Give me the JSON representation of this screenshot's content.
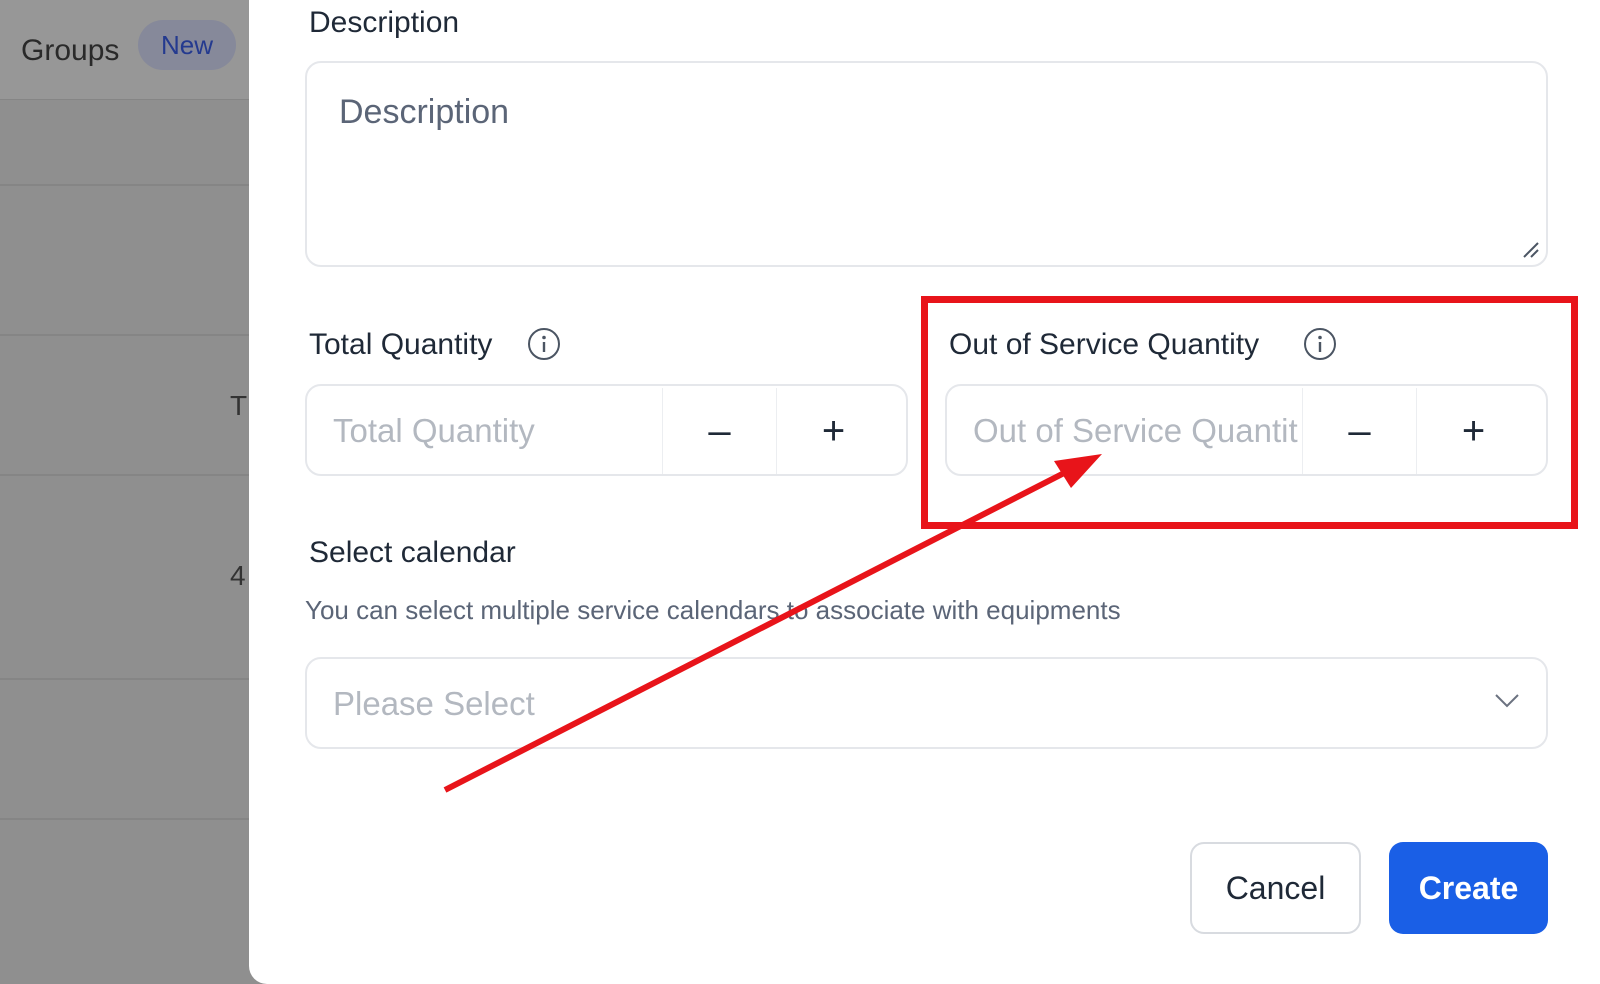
{
  "background": {
    "title": "Groups",
    "badge": "New",
    "fragment_1": "T",
    "fragment_2": "4"
  },
  "form": {
    "description": {
      "label": "Description",
      "placeholder": "Description"
    },
    "total_quantity": {
      "label": "Total Quantity",
      "placeholder": "Total Quantity",
      "decrement": "–",
      "increment": "+"
    },
    "out_of_service_quantity": {
      "label": "Out of Service Quantity",
      "placeholder": "Out of Service Quantit",
      "decrement": "–",
      "increment": "+"
    },
    "calendar": {
      "label": "Select calendar",
      "helper": "You can select multiple service calendars to associate with equipments",
      "placeholder": "Please Select"
    },
    "actions": {
      "cancel": "Cancel",
      "create": "Create"
    }
  },
  "colors": {
    "primary": "#1a5fe6",
    "annotation": "#e8141a",
    "overlay": "#8e8e8e"
  }
}
